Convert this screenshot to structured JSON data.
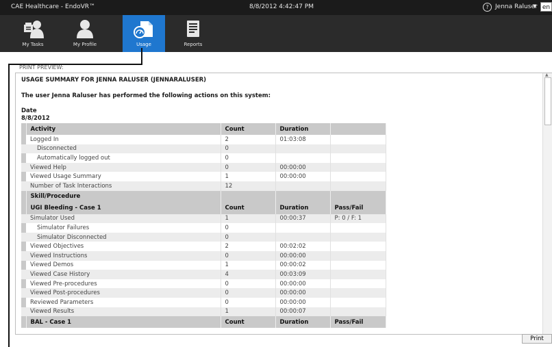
{
  "titlebar": {
    "app_title": "CAE Healthcare - EndoVR™",
    "datetime": "8/8/2012 4:42:47 PM",
    "help_icon": "?",
    "user_name": "Jenna Raluser",
    "language": "en"
  },
  "nav": [
    {
      "label": "My Tasks",
      "icon": "tasks-icon"
    },
    {
      "label": "My Profile",
      "icon": "profile-icon"
    },
    {
      "label": "Usage",
      "icon": "usage-icon"
    },
    {
      "label": "Reports",
      "icon": "reports-icon"
    }
  ],
  "colors": {
    "active_tab": "#1f77cf",
    "titlebar": "#1b1b1b",
    "navbar": "#2b2b2b",
    "table_header": "#c9c9c9"
  },
  "preview": {
    "label": "PRINT PREVIEW:",
    "title": "USAGE SUMMARY FOR JENNA RALUSER (JENNARALUSER)",
    "intro": "The user Jenna Raluser has performed the following actions on this system:",
    "date_label": "Date",
    "date_value": "8/8/2012"
  },
  "activity_table": {
    "headers": [
      "Activity",
      "Count",
      "Duration",
      ""
    ],
    "rows": [
      [
        "Logged In",
        "2",
        "01:03:08",
        ""
      ],
      [
        "Disconnected",
        "0",
        "",
        ""
      ],
      [
        "Automatically logged out",
        "0",
        "",
        ""
      ],
      [
        "Viewed Help",
        "0",
        "00:00:00",
        ""
      ],
      [
        "Viewed Usage Summary",
        "1",
        "00:00:00",
        ""
      ],
      [
        "Number of Task Interactions",
        "12",
        "",
        ""
      ]
    ]
  },
  "skill_section": {
    "header": "Skill/Procedure",
    "case1_headers": [
      "UGI Bleeding - Case 1",
      "Count",
      "Duration",
      "Pass/Fail"
    ],
    "case1_rows": [
      [
        "Simulator Used",
        "1",
        "00:00:37",
        "P: 0 / F: 1"
      ],
      [
        "Simulator Failures",
        "0",
        "",
        ""
      ],
      [
        "Simulator Disconnected",
        "0",
        "",
        ""
      ],
      [
        "Viewed Objectives",
        "2",
        "00:02:02",
        ""
      ],
      [
        "Viewed Instructions",
        "0",
        "00:00:00",
        ""
      ],
      [
        "Viewed Demos",
        "1",
        "00:00:02",
        ""
      ],
      [
        "Viewed Case History",
        "4",
        "00:03:09",
        ""
      ],
      [
        "Viewed Pre-procedures",
        "0",
        "00:00:00",
        ""
      ],
      [
        "Viewed Post-procedures",
        "0",
        "00:00:00",
        ""
      ],
      [
        "Reviewed Parameters",
        "0",
        "00:00:00",
        ""
      ],
      [
        "Viewed Results",
        "1",
        "00:00:07",
        ""
      ]
    ],
    "next_headers": [
      "BAL - Case 1",
      "Count",
      "Duration",
      "Pass/Fail"
    ]
  },
  "print_button": "Print"
}
